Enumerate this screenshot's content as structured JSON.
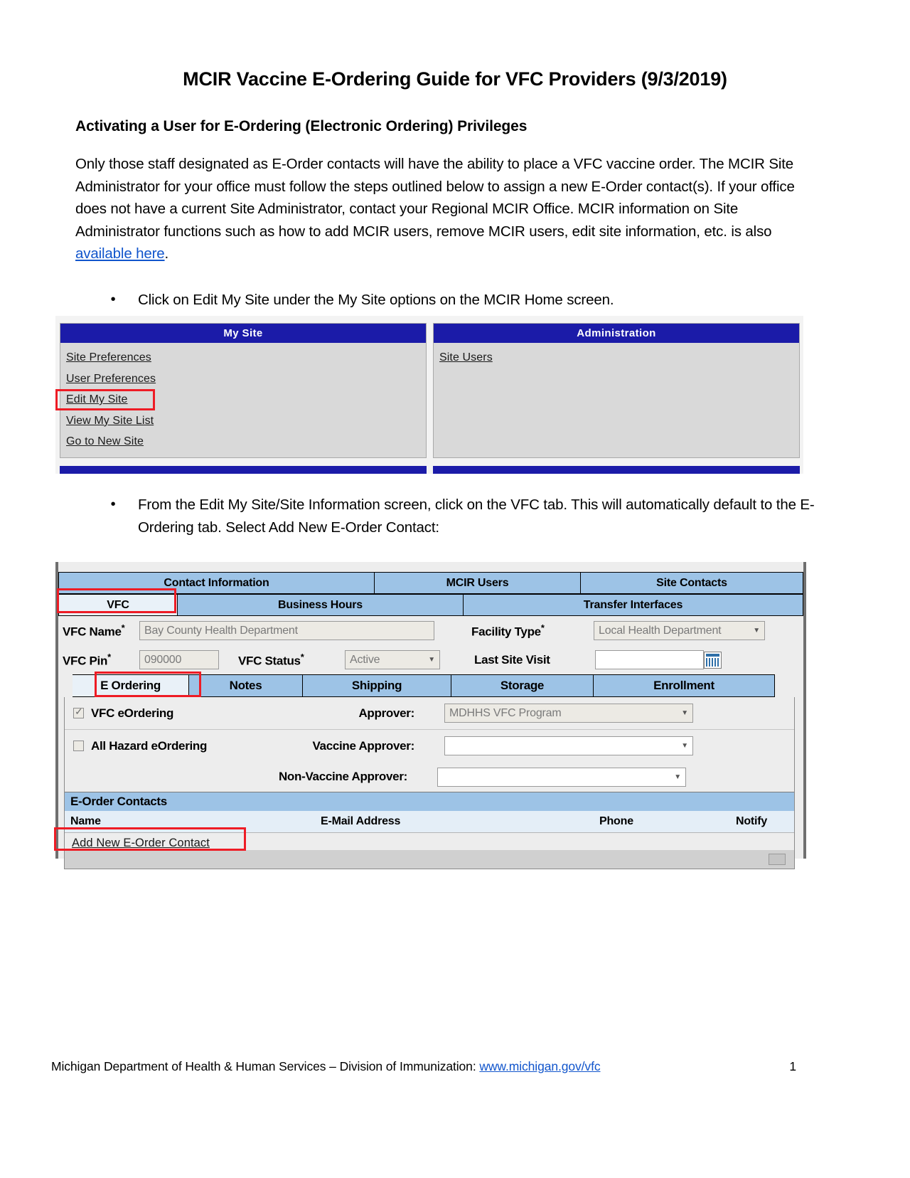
{
  "document": {
    "title": "MCIR Vaccine E-Ordering Guide for VFC Providers (9/3/2019)",
    "subtitle": "Activating a User for E-Ordering (Electronic Ordering) Privileges",
    "paragraph_part1": "Only those staff designated as E-Order contacts will have the ability to place a VFC vaccine order. The MCIR Site Administrator for your office must follow the steps outlined below to assign a new E-Order contact(s). If your office does not have a current Site Administrator, contact your Regional MCIR Office. MCIR information on Site Administrator functions such as how to add MCIR users, remove MCIR users, edit site information, etc. is also ",
    "paragraph_link": "available here",
    "paragraph_part2": ".",
    "bullet1": "Click on Edit My Site under the My Site options on the MCIR Home screen.",
    "bullet2": "From the Edit My Site/Site Information screen, click on the VFC tab. This will automatically default to the E-Ordering tab. Select Add New E-Order Contact:"
  },
  "screenshot_my_site": {
    "my_site": {
      "header": "My Site",
      "links": [
        "Site Preferences",
        "User Preferences",
        "Edit My Site",
        "View My Site List",
        "Go to New Site"
      ]
    },
    "administration": {
      "header": "Administration",
      "links": [
        "Site Users"
      ]
    }
  },
  "screenshot_vfc": {
    "tabs_row1": [
      "Contact Information",
      "MCIR Users",
      "Site Contacts"
    ],
    "tabs_row2": [
      "VFC",
      "Business Hours",
      "Transfer Interfaces"
    ],
    "selected_tab_row2": "VFC",
    "fields": {
      "vfc_name_label": "VFC Name",
      "vfc_name_value": "Bay County Health Department",
      "facility_type_label": "Facility Type",
      "facility_type_value": "Local Health Department",
      "vfc_pin_label": "VFC Pin",
      "vfc_pin_value": "090000",
      "vfc_status_label": "VFC Status",
      "vfc_status_value": "Active",
      "last_site_visit_label": "Last Site Visit",
      "last_site_visit_value": "",
      "required_marker": "*"
    },
    "subtabs": [
      "E Ordering",
      "Notes",
      "Shipping",
      "Storage",
      "Enrollment"
    ],
    "selected_subtab": "E Ordering",
    "eordering": {
      "vfc_eordering_label": "VFC eOrdering",
      "vfc_eordering_checked": true,
      "all_hazard_label": "All Hazard eOrdering",
      "all_hazard_checked": false,
      "approver_label": "Approver:",
      "approver_value": "MDHHS VFC Program",
      "vaccine_approver_label": "Vaccine Approver:",
      "vaccine_approver_value": "",
      "non_vaccine_approver_label": "Non-Vaccine Approver:",
      "non_vaccine_approver_value": ""
    },
    "contacts": {
      "section_title": "E-Order Contacts",
      "columns": [
        "Name",
        "E-Mail Address",
        "Phone",
        "Notify"
      ],
      "add_link": "Add New E-Order Contact",
      "rows": []
    }
  },
  "footer": {
    "text": "Michigan Department of Health & Human Services – Division of Immunization: ",
    "link": "www.michigan.gov/vfc",
    "page_number": "1"
  },
  "colors": {
    "panel_header_blue": "#1b1ba8",
    "panel_body_gray": "#d9d9d9",
    "tab_blue": "#9dc3e6",
    "tab_selected": "#e9f1f8",
    "annotation_red": "#ee1c25",
    "hyperlink_blue": "#1155cc"
  }
}
